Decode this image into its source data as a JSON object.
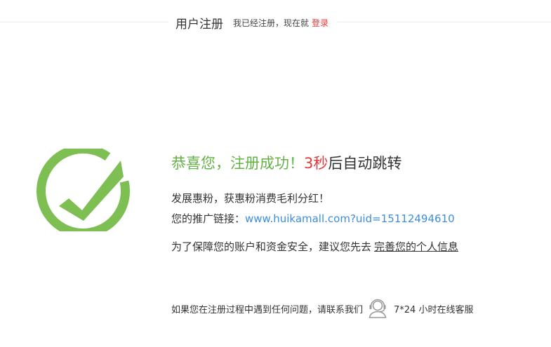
{
  "header": {
    "title": "用户注册",
    "note": "我已经注册，现在就",
    "login_label": "登录"
  },
  "success": {
    "heading_part1": "恭喜您，注册成功！",
    "countdown": "3秒",
    "heading_part2": "后自动跳转"
  },
  "info": {
    "line1": "发展惠粉，获惠粉消费毛利分红！",
    "promo_label": "您的推广链接：",
    "promo_url": "www.huikamall.com?uid=15112494610",
    "security_text": "为了保障您的账户和资金安全，建议您先去",
    "complete_link": "完善您的个人信息"
  },
  "footer": {
    "help_text": "如果您在注册过程中遇到任何问题，请联系我们",
    "service_hours": "7*24 小时在线客服",
    "service_icon": "customer-service-icon"
  },
  "colors": {
    "success_green": "#64b246",
    "icon_green": "#7dbf52",
    "countdown_red": "#e4393c",
    "link_blue": "#3c8de0"
  }
}
